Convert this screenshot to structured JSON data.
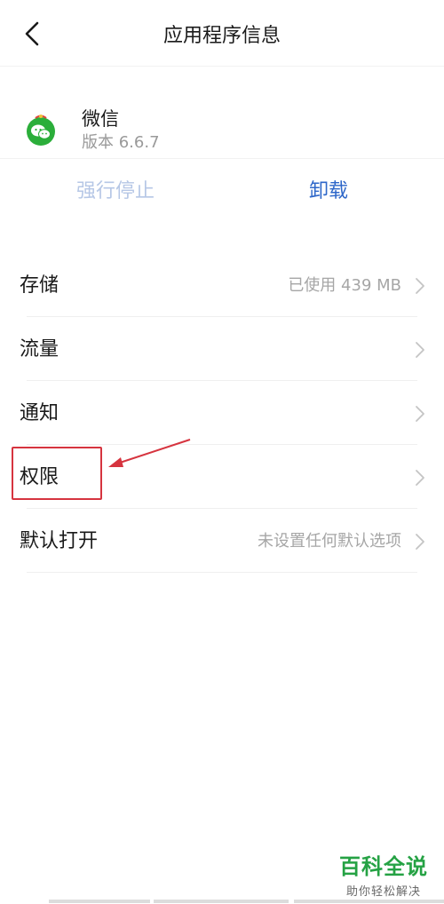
{
  "header": {
    "title": "应用程序信息",
    "back_icon": "chevron-left-icon"
  },
  "app": {
    "name": "微信",
    "version": "版本 6.6.7",
    "icon": "wechat-icon",
    "icon_color": "#2bae3a"
  },
  "actions": {
    "force_stop": "强行停止",
    "uninstall": "卸载",
    "uninstall_color": "#2e67c9",
    "force_stop_color": "#b6c7e6"
  },
  "settings": {
    "items": [
      {
        "label": "存储",
        "value": "已使用 439 MB"
      },
      {
        "label": "流量",
        "value": ""
      },
      {
        "label": "通知",
        "value": ""
      },
      {
        "label": "权限",
        "value": ""
      },
      {
        "label": "默认打开",
        "value": "未设置任何默认选项"
      }
    ]
  },
  "annotation": {
    "color": "#d6343f",
    "target": "权限"
  },
  "watermark": {
    "title": "百科全说",
    "subtitle": "助你轻松解决"
  }
}
